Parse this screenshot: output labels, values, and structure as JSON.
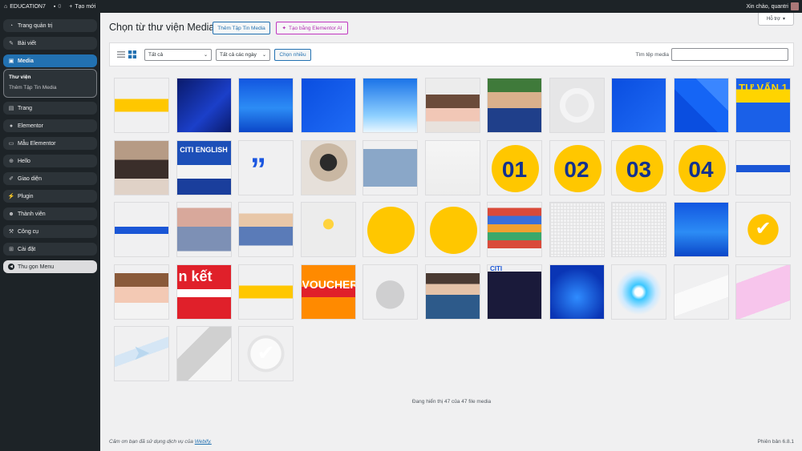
{
  "adminbar": {
    "site_name": "EDUCATION7",
    "comments_count": "0",
    "new_label": "Tạo mới",
    "greeting": "Xin chào, quantri"
  },
  "sidebar": {
    "items": [
      {
        "label": "Trang quản trị",
        "icon": "dashboard-icon",
        "glyph": "◔"
      },
      {
        "label": "Bài viết",
        "icon": "pin-icon",
        "glyph": "✎"
      },
      {
        "label": "Media",
        "icon": "media-icon",
        "glyph": "▣"
      },
      {
        "label": "Trang",
        "icon": "page-icon",
        "glyph": "▤"
      },
      {
        "label": "Elementor",
        "icon": "elementor-icon",
        "glyph": "●"
      },
      {
        "label": "Mẫu Elementor",
        "icon": "folder-icon",
        "glyph": "▭"
      },
      {
        "label": "Hello",
        "icon": "hello-icon",
        "glyph": "⊕"
      },
      {
        "label": "Giao diện",
        "icon": "brush-icon",
        "glyph": "✐"
      },
      {
        "label": "Plugin",
        "icon": "plugin-icon",
        "glyph": "⚡"
      },
      {
        "label": "Thành viên",
        "icon": "users-icon",
        "glyph": "☻"
      },
      {
        "label": "Công cụ",
        "icon": "wrench-icon",
        "glyph": "⚒"
      },
      {
        "label": "Cài đặt",
        "icon": "settings-icon",
        "glyph": "⊞"
      }
    ],
    "submenu": {
      "current": "Thư viện",
      "add_new": "Thêm Tập Tin Media"
    },
    "collapse_label": "Thu gọn Menu"
  },
  "help_label": "Hỗ trợ",
  "page_title": "Chọn từ thư viện Media",
  "add_media_button": "Thêm Tập Tin Media",
  "ai_button": "Tạo bằng Elementor AI",
  "filters": {
    "type_value": "Tất cả",
    "date_value": "Tất cả các ngày",
    "bulk_select": "Chọn nhiều",
    "search_label": "Tìm tệp media",
    "search_value": ""
  },
  "tiles": [
    {
      "text": "",
      "type": "yellow-stroke"
    },
    {
      "text": "",
      "type": "blue-dark"
    },
    {
      "text": "",
      "type": "blue-city"
    },
    {
      "text": "",
      "type": "blue-solid"
    },
    {
      "text": "",
      "type": "blue-light"
    },
    {
      "text": "",
      "type": "girl"
    },
    {
      "text": "",
      "type": "man"
    },
    {
      "text": "",
      "type": "logo-faint"
    },
    {
      "text": "",
      "type": "blue-solid"
    },
    {
      "text": "",
      "type": "blue-diag"
    },
    {
      "text": "TƯ VẤN 1",
      "type": "banner-yellow"
    },
    {
      "text": "",
      "type": "group"
    },
    {
      "text": "CITI ENGLISH",
      "type": "citi-group"
    },
    {
      "text": "",
      "type": "quote"
    },
    {
      "text": "",
      "type": "hat-girl"
    },
    {
      "text": "",
      "type": "jeans"
    },
    {
      "text": "",
      "type": "paper"
    },
    {
      "text": "01",
      "type": "number"
    },
    {
      "text": "02",
      "type": "number"
    },
    {
      "text": "03",
      "type": "number"
    },
    {
      "text": "04",
      "type": "number"
    },
    {
      "text": "",
      "type": "blue-line"
    },
    {
      "text": "",
      "type": "blue-line"
    },
    {
      "text": "",
      "type": "walker"
    },
    {
      "text": "",
      "type": "jumper"
    },
    {
      "text": "",
      "type": "rocket"
    },
    {
      "text": "",
      "type": "yellow-blob"
    },
    {
      "text": "",
      "type": "yellow-blob"
    },
    {
      "text": "",
      "type": "books"
    },
    {
      "text": "",
      "type": "grid"
    },
    {
      "text": "",
      "type": "grid"
    },
    {
      "text": "",
      "type": "blue-city"
    },
    {
      "text": "",
      "type": "badge"
    },
    {
      "text": "",
      "type": "smile-girl"
    },
    {
      "text": "n kết",
      "type": "red-banner"
    },
    {
      "text": "",
      "type": "yellow-stroke"
    },
    {
      "text": "VOUCHER",
      "type": "voucher"
    },
    {
      "text": "",
      "type": "cloud"
    },
    {
      "text": "",
      "type": "students"
    },
    {
      "text": "CITI",
      "type": "target"
    },
    {
      "text": "",
      "type": "blue-city-dark"
    },
    {
      "text": "",
      "type": "glow"
    },
    {
      "text": "",
      "type": "faint-shape"
    },
    {
      "text": "",
      "type": "pink-card"
    },
    {
      "text": "",
      "type": "plane"
    },
    {
      "text": "",
      "type": "curl"
    },
    {
      "text": "",
      "type": "check"
    }
  ],
  "count_text": "Đang hiển thị 47 của 47 file media",
  "footer": {
    "thanks_prefix": "Cảm ơn bạn đã sử dụng dịch vụ của",
    "brand": "Webify.",
    "version": "Phiên bản 6.8.1"
  }
}
